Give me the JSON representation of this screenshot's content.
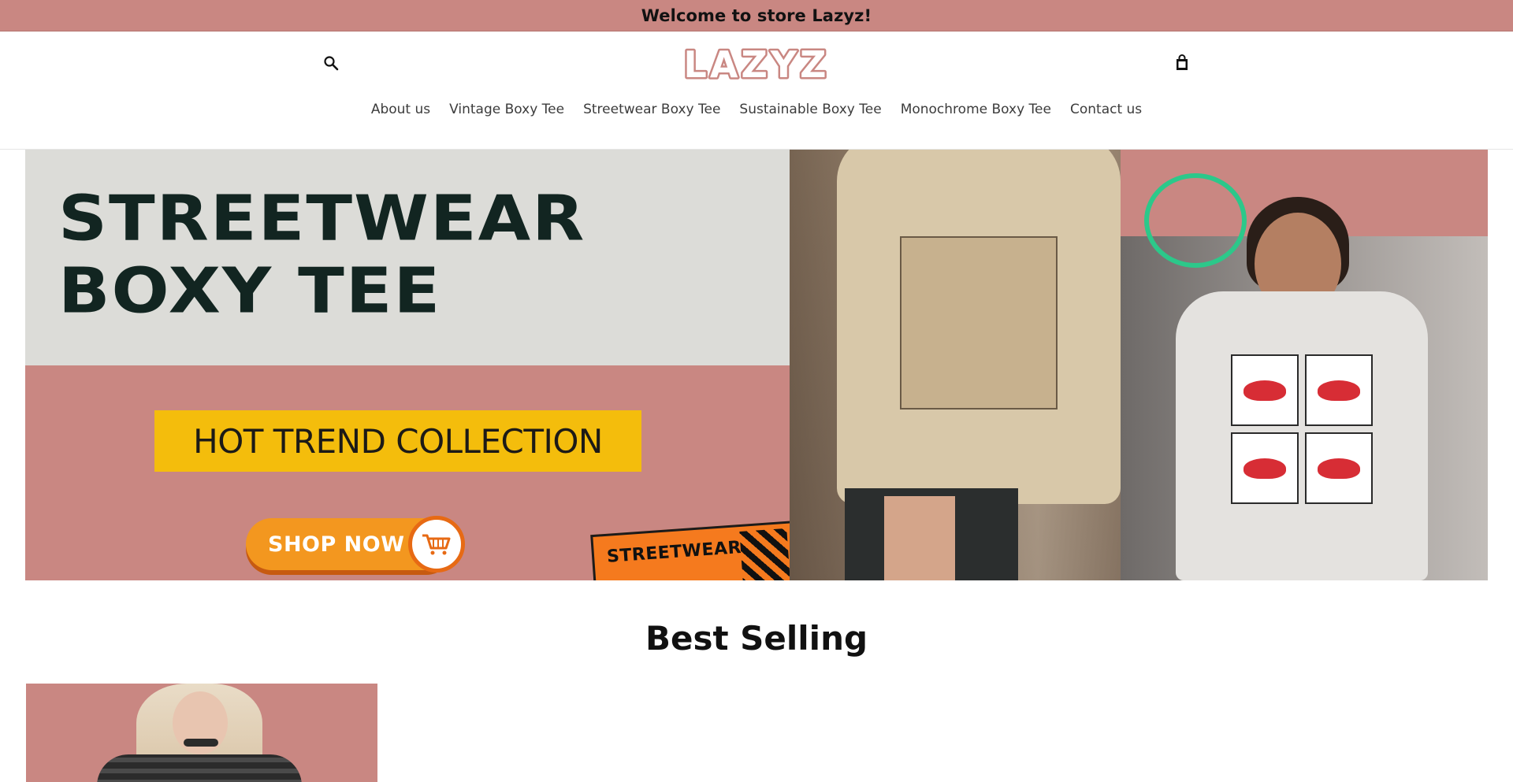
{
  "announcement": {
    "text": "Welcome to store Lazyz!"
  },
  "header": {
    "logo_text": "LAZYZ",
    "search_icon": "search-icon",
    "cart_icon": "shopping-bag-icon"
  },
  "nav": {
    "items": [
      {
        "label": "About us"
      },
      {
        "label": "Vintage Boxy Tee"
      },
      {
        "label": "Streetwear Boxy Tee"
      },
      {
        "label": "Sustainable Boxy Tee"
      },
      {
        "label": "Monochrome Boxy Tee"
      },
      {
        "label": "Contact us"
      }
    ]
  },
  "hero": {
    "title_line1": "STREETWEAR",
    "title_line2": "BOXY  TEE",
    "badge": "HOT TREND COLLECTION",
    "cta": "SHOP NOW",
    "ticket_label": "STREETWEAR"
  },
  "best_selling": {
    "title": "Best Selling"
  },
  "colors": {
    "brand_pink": "#c98782",
    "dark_green": "#122521",
    "yellow": "#f4bd0c",
    "orange": "#f3971f"
  }
}
